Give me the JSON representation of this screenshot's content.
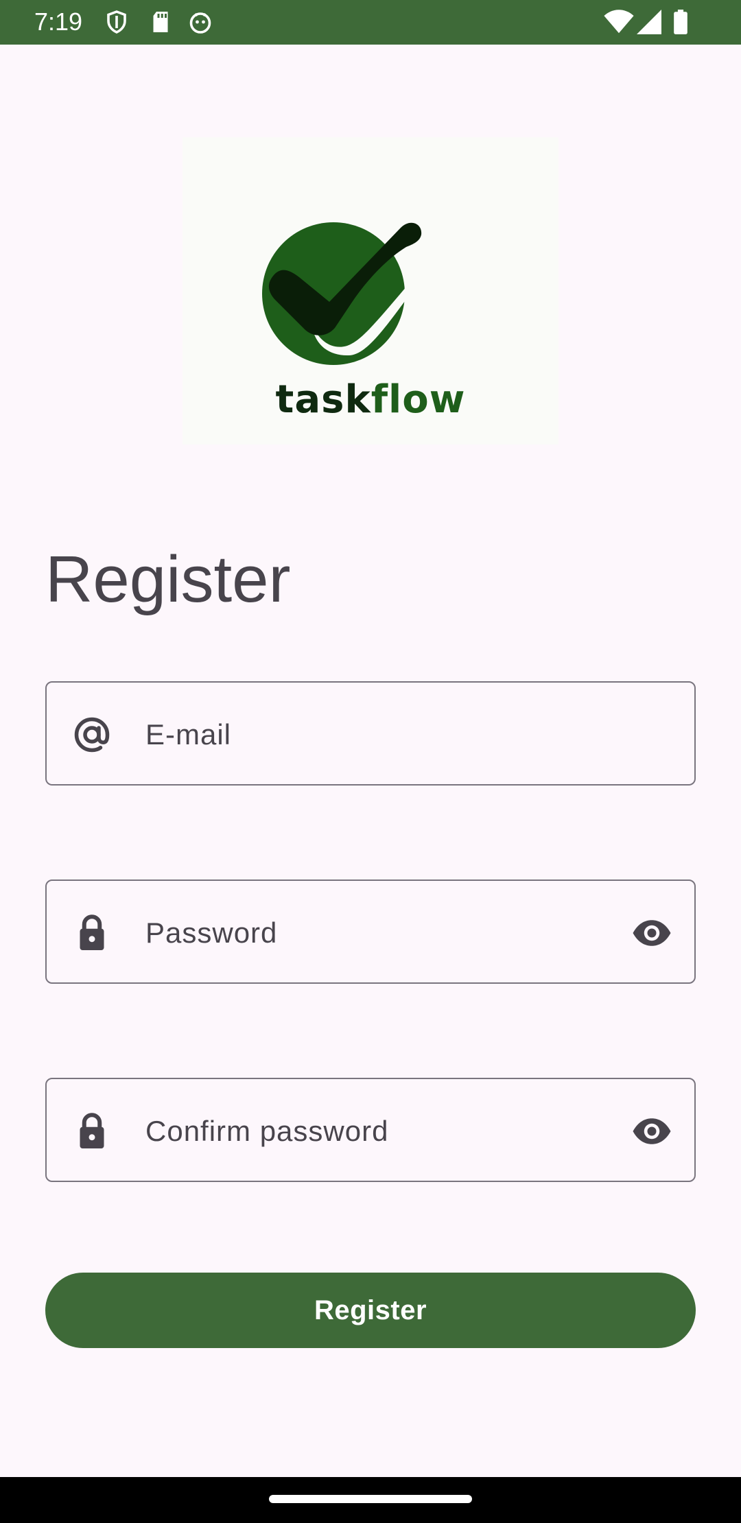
{
  "status_bar": {
    "time": "7:19",
    "icons_left": [
      "shield-icon",
      "sd-card-icon",
      "android-debug-icon"
    ],
    "icons_right": [
      "wifi-icon",
      "cell-signal-icon",
      "battery-icon"
    ],
    "color": "#3E6A38"
  },
  "logo": {
    "word_part1": "task",
    "word_part2": "flow",
    "dark_color": "#0F2A10",
    "green_color": "#1E5E1A"
  },
  "page": {
    "title": "Register"
  },
  "form": {
    "email": {
      "placeholder": "E-mail",
      "icon": "at-icon"
    },
    "password": {
      "placeholder": "Password",
      "icon": "lock-icon",
      "toggle_icon": "eye-icon"
    },
    "confirm_password": {
      "placeholder": "Confirm password",
      "icon": "lock-icon",
      "toggle_icon": "eye-icon"
    }
  },
  "actions": {
    "register_label": "Register",
    "accent": "#3E6A38"
  }
}
